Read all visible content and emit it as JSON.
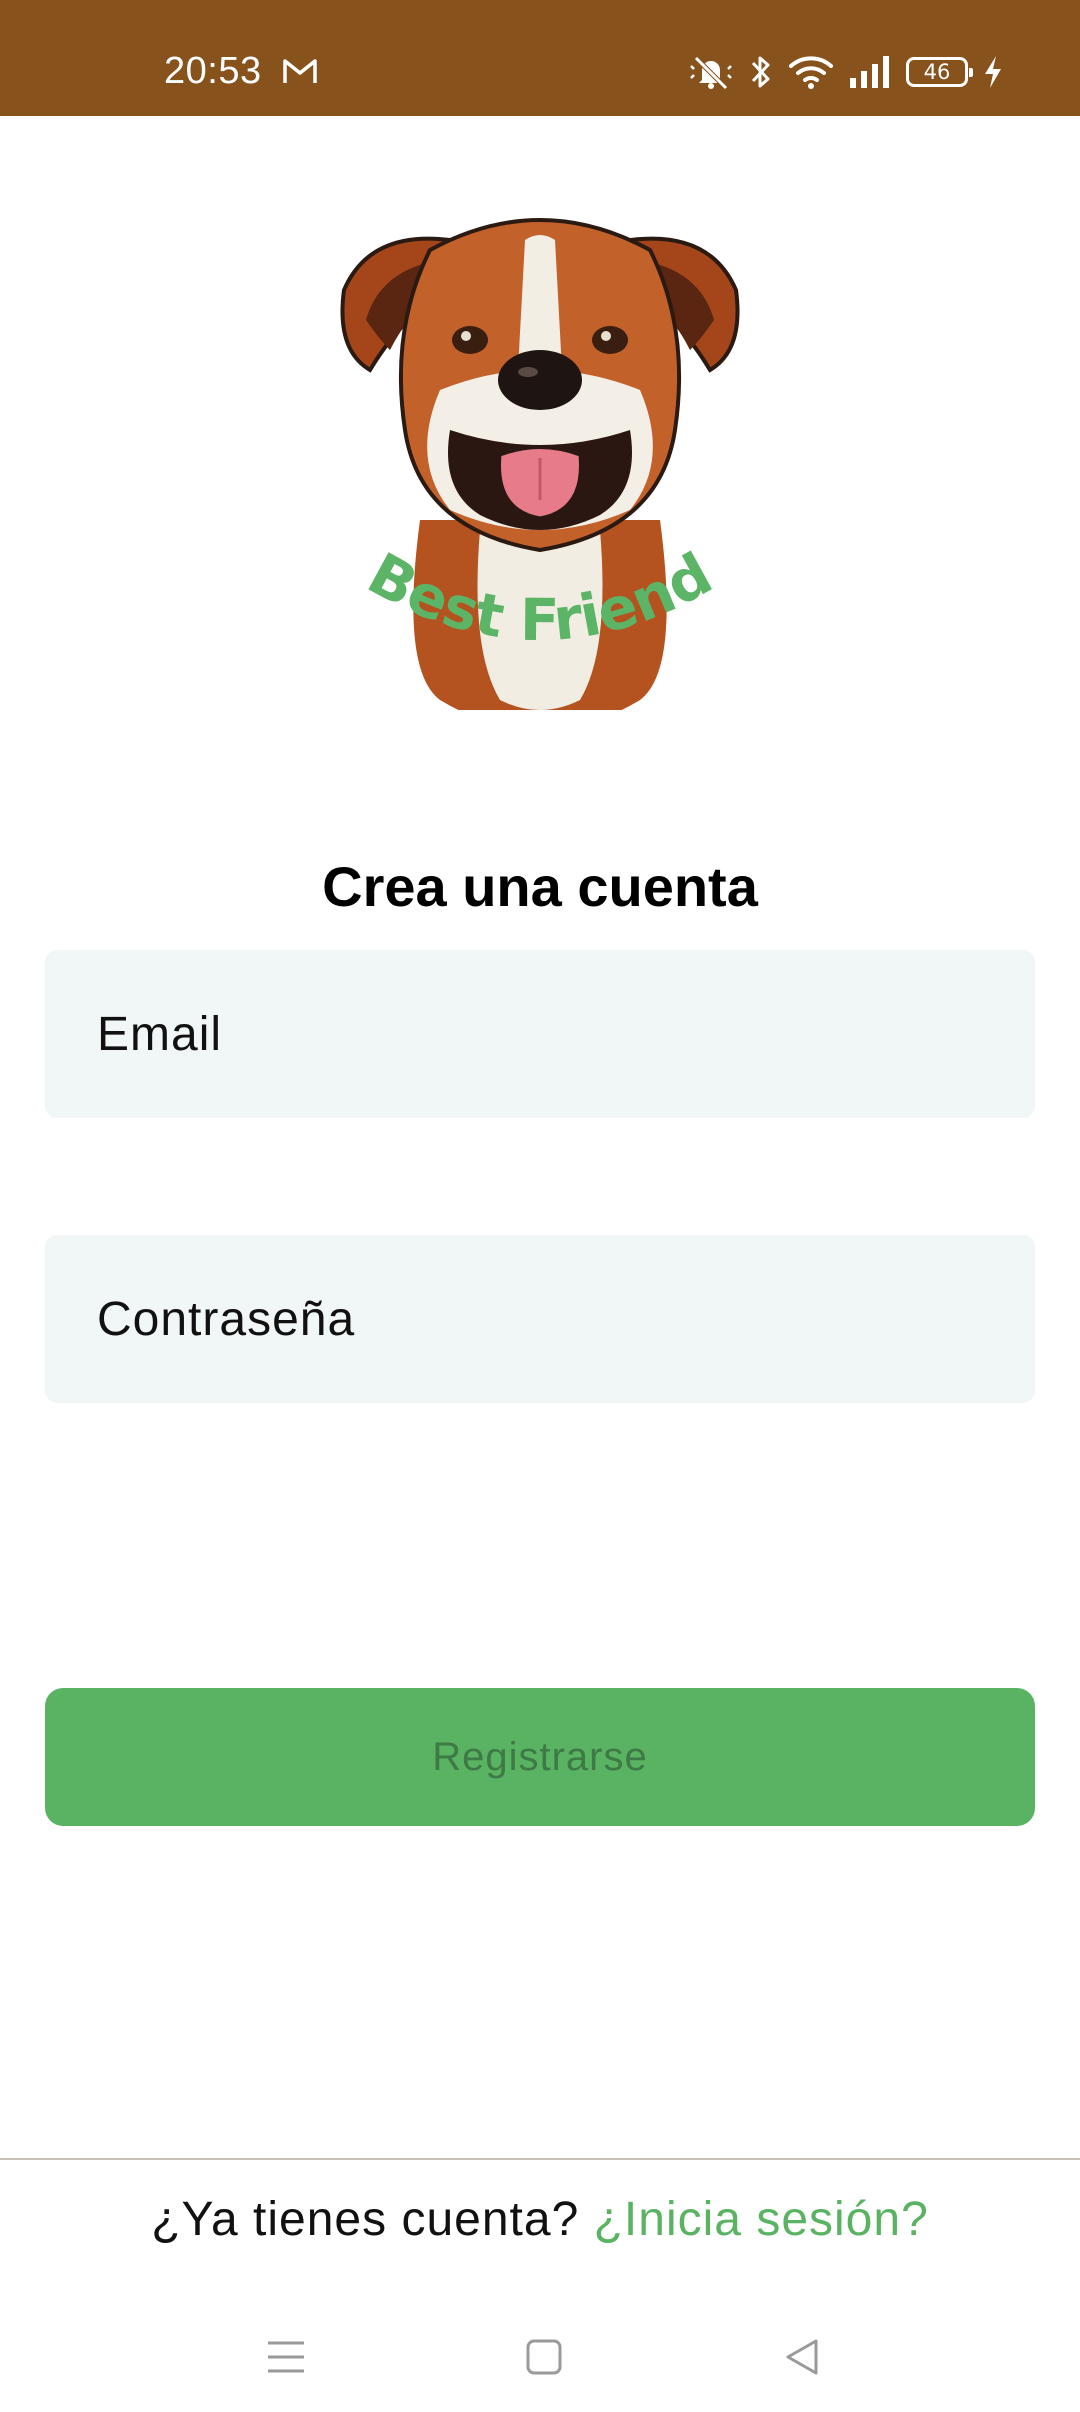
{
  "status_bar": {
    "time": "20:53",
    "battery_level": "46",
    "icons": [
      "gmail-icon",
      "mute-icon",
      "bluetooth-icon",
      "wifi-icon",
      "signal-icon",
      "battery-icon",
      "charging-icon"
    ],
    "background_color": "#87521c"
  },
  "logo": {
    "text": "Best Friend",
    "icon": "boxer-dog-logo"
  },
  "form": {
    "title": "Crea una cuenta",
    "email_placeholder": "Email",
    "password_placeholder": "Contraseña",
    "submit_label": "Registrarse"
  },
  "footer": {
    "question": "¿Ya tienes cuenta?",
    "login_link": "¿Inicia sesión?"
  },
  "nav_bar": {
    "icons": [
      "menu-icon",
      "home-icon",
      "back-icon"
    ]
  },
  "colors": {
    "accent_green": "#5ab363",
    "field_bg": "#f1f6f6",
    "button_text": "#3d7a45"
  }
}
